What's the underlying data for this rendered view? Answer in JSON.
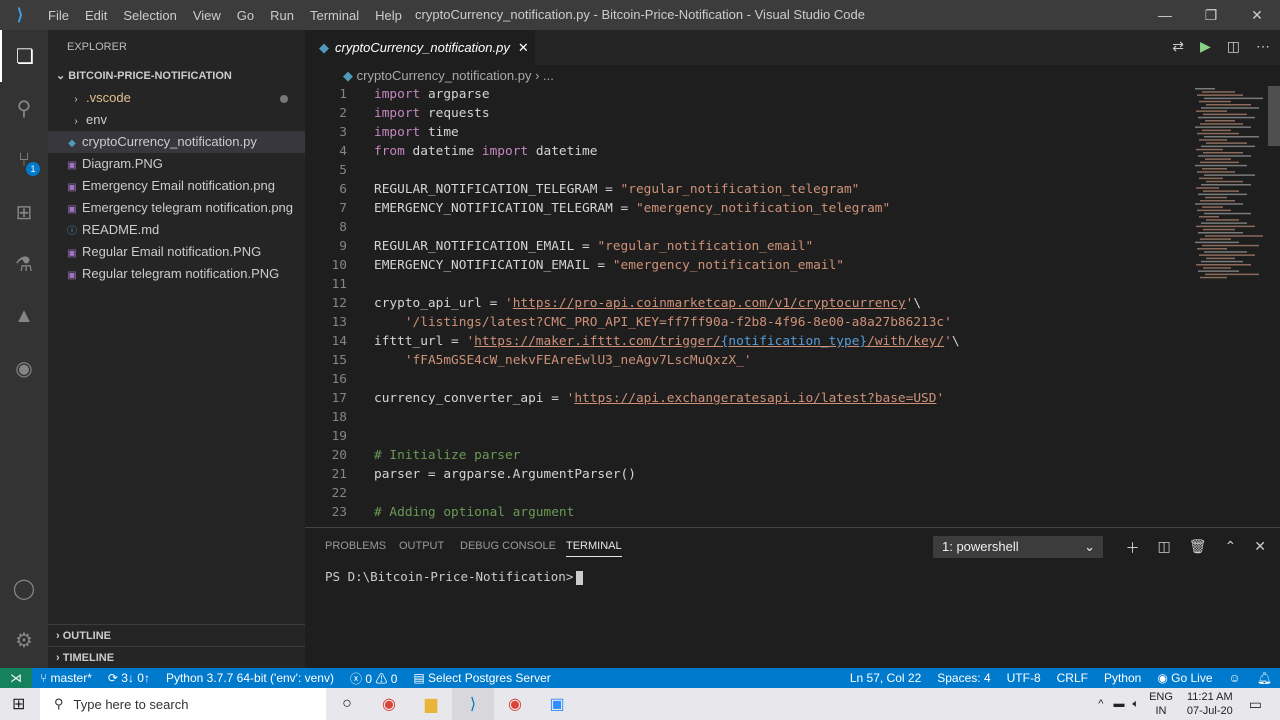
{
  "menu": [
    "File",
    "Edit",
    "Selection",
    "View",
    "Go",
    "Run",
    "Terminal",
    "Help"
  ],
  "window_title": "cryptoCurrency_notification.py - Bitcoin-Price-Notification - Visual Studio Code",
  "explorer": {
    "title": "EXPLORER",
    "folder": "BITCOIN-PRICE-NOTIFICATION",
    "items": [
      {
        "label": ".vscode",
        "type": "folder",
        "modified": true
      },
      {
        "label": "env",
        "type": "folder"
      },
      {
        "label": "cryptoCurrency_notification.py",
        "type": "python",
        "selected": true
      },
      {
        "label": "Diagram.PNG",
        "type": "image"
      },
      {
        "label": "Emergency Email notification.png",
        "type": "image"
      },
      {
        "label": "Emergency telegram notification.png",
        "type": "image"
      },
      {
        "label": "README.md",
        "type": "markdown"
      },
      {
        "label": "Regular Email notification.PNG",
        "type": "image"
      },
      {
        "label": "Regular telegram notification.PNG",
        "type": "image"
      }
    ],
    "outline": "OUTLINE",
    "timeline": "TIMELINE"
  },
  "activity_badge": "1",
  "tab": {
    "label": "cryptoCurrency_notification.py"
  },
  "breadcrumb": [
    "cryptoCurrency_notification.py",
    "..."
  ],
  "code": [
    [
      [
        "import",
        "k"
      ],
      [
        " argparse",
        ""
      ]
    ],
    [
      [
        "import",
        "k"
      ],
      [
        " requests",
        ""
      ]
    ],
    [
      [
        "import",
        "k"
      ],
      [
        " time",
        ""
      ]
    ],
    [
      [
        "from",
        "k"
      ],
      [
        " datetime ",
        ""
      ],
      [
        "import",
        "k"
      ],
      [
        " datetime",
        ""
      ]
    ],
    [],
    [
      [
        "REGULAR_NOTIFICATION_TELEGRAM = ",
        ""
      ],
      [
        "\"regular_notification_telegram\"",
        "s"
      ]
    ],
    [
      [
        "EMERGENCY_NOTIFICATION_TELEGRAM = ",
        ""
      ],
      [
        "\"emergency_notification_telegram\"",
        "s"
      ]
    ],
    [],
    [
      [
        "REGULAR_NOTIFICATION_EMAIL = ",
        ""
      ],
      [
        "\"regular_notification_email\"",
        "s"
      ]
    ],
    [
      [
        "EMERGENCY_NOTIFICATION_EMAIL = ",
        ""
      ],
      [
        "\"emergency_notification_email\"",
        "s"
      ]
    ],
    [],
    [
      [
        "crypto_api_url = ",
        ""
      ],
      [
        "'",
        "s"
      ],
      [
        "https://pro-api.coinmarketcap.com/v1/cryptocurrency",
        "s u"
      ],
      [
        "'",
        "s"
      ],
      [
        "\\",
        ""
      ]
    ],
    [
      [
        "    ",
        ""
      ],
      [
        "'/listings/latest?CMC_PRO_API_KEY=ff7ff90a-f2b8-4f96-8e00-a8a27b86213c'",
        "s"
      ]
    ],
    [
      [
        "ifttt_url = ",
        ""
      ],
      [
        "'",
        "s"
      ],
      [
        "https://maker.ifttt.com/trigger/",
        "s u"
      ],
      [
        "{notification_type}",
        "p u"
      ],
      [
        "/with/key/",
        "s u"
      ],
      [
        "'",
        "s"
      ],
      [
        "\\",
        ""
      ]
    ],
    [
      [
        "    ",
        ""
      ],
      [
        "'fFA5mGSE4cW_nekvFEAreEwlU3_neAgv7LscMuQxzX_'",
        "s"
      ]
    ],
    [],
    [
      [
        "currency_converter_api = ",
        ""
      ],
      [
        "'",
        "s"
      ],
      [
        "https://api.exchangeratesapi.io/latest?base=USD",
        "s u"
      ],
      [
        "'",
        "s"
      ]
    ],
    [],
    [],
    [
      [
        "# Initialize parser",
        "c"
      ]
    ],
    [
      [
        "parser = argparse.ArgumentParser()",
        ""
      ]
    ],
    [],
    [
      [
        "# Adding optional argument",
        "c"
      ]
    ]
  ],
  "panel": {
    "tabs": [
      "PROBLEMS",
      "OUTPUT",
      "DEBUG CONSOLE",
      "TERMINAL"
    ],
    "active": "TERMINAL",
    "terminal_select": "1: powershell",
    "prompt": "PS D:\\Bitcoin-Price-Notification>"
  },
  "status": {
    "branch": "master*",
    "sync": "3↓ 0↑",
    "interpreter": "Python 3.7.7 64-bit ('env': venv)",
    "errors": "0",
    "warnings": "0",
    "postgres": "Select Postgres Server",
    "position": "Ln 57, Col 22",
    "spaces": "Spaces: 4",
    "encoding": "UTF-8",
    "eol": "CRLF",
    "language": "Python",
    "golive": "Go Live"
  },
  "taskbar": {
    "search_placeholder": "Type here to search",
    "lang": "ENG",
    "region": "IN",
    "time": "11:21 AM",
    "date": "07-Jul-20"
  },
  "colors": {
    "accent": "#007acc",
    "remote": "#16825d"
  }
}
